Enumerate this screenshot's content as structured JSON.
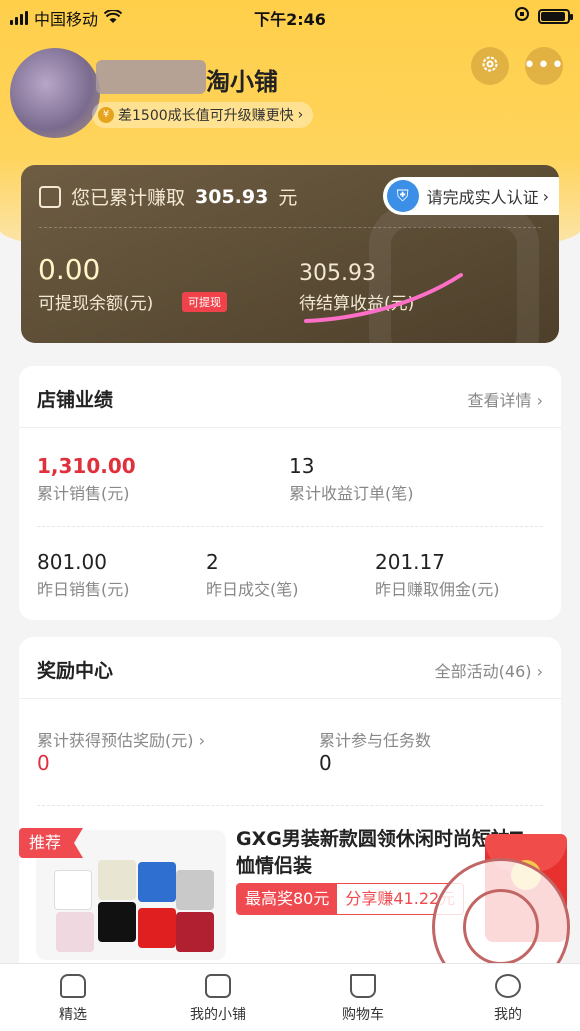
{
  "status_bar": {
    "carrier": "中国移动",
    "time": "下午2:46"
  },
  "header": {
    "shop_name": "淘小铺",
    "growth_text": "差1500成长值可升级赚更快"
  },
  "earnings": {
    "summary_prefix": "您已累计赚取",
    "total_amount": "305.93",
    "summary_unit": "元",
    "verify_label": "请完成实人认证",
    "balance_value": "0.00",
    "balance_label": "可提现余额(元)",
    "withdraw_tag": "可提现",
    "pending_value": "305.93",
    "pending_label": "待结算收益(元)"
  },
  "performance": {
    "title": "店铺业绩",
    "link": "查看详情",
    "total_sales_value": "1,310.00",
    "total_sales_label": "累计销售(元)",
    "income_orders_value": "13",
    "income_orders_label": "累计收益订单(笔)",
    "yesterday_sales_value": "801.00",
    "yesterday_sales_label": "昨日销售(元)",
    "yesterday_deals_value": "2",
    "yesterday_deals_label": "昨日成交(笔)",
    "yesterday_commission_value": "201.17",
    "yesterday_commission_label": "昨日赚取佣金(元)"
  },
  "rewards": {
    "title": "奖励中心",
    "link": "全部活动(46)",
    "est_reward_label": "累计获得预估奖励(元)",
    "est_reward_value": "0",
    "tasks_label": "累计参与任务数",
    "tasks_value": "0"
  },
  "product": {
    "tag": "推荐",
    "title": "GXG男装新款圆领休闲时尚短袖T恤情侣装",
    "max_prize": "最高奖80元",
    "share_earn": "分享赚41.22元"
  },
  "tabbar": {
    "tabs": [
      "精选",
      "我的小铺",
      "购物车",
      "我的"
    ]
  },
  "colors": {
    "accent_yellow": "#ffcf4a",
    "card_brown": "#5a4a33",
    "red": "#e0303c"
  },
  "icons": {
    "settings": "gear-icon",
    "more": "more-icon",
    "verify": "shield-icon"
  }
}
